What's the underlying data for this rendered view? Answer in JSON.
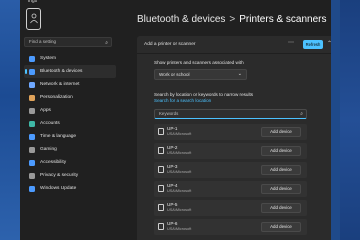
{
  "window": {
    "title": "ings"
  },
  "sidebar": {
    "search_placeholder": "Find a setting",
    "items": [
      {
        "label": "System",
        "icon": "system-icon",
        "color": "#4c9bff"
      },
      {
        "label": "Bluetooth & devices",
        "icon": "bluetooth-icon",
        "color": "#4c9bff",
        "active": true
      },
      {
        "label": "Network & internet",
        "icon": "network-icon",
        "color": "#6fa8ff"
      },
      {
        "label": "Personalization",
        "icon": "brush-icon",
        "color": "#e0a35a"
      },
      {
        "label": "Apps",
        "icon": "apps-icon",
        "color": "#9a9a9a"
      },
      {
        "label": "Accounts",
        "icon": "accounts-icon",
        "color": "#3fb8a6"
      },
      {
        "label": "Time & language",
        "icon": "globe-icon",
        "color": "#4c9bff"
      },
      {
        "label": "Gaming",
        "icon": "gaming-icon",
        "color": "#9a9a9a"
      },
      {
        "label": "Accessibility",
        "icon": "accessibility-icon",
        "color": "#4c9bff"
      },
      {
        "label": "Privacy & security",
        "icon": "shield-icon",
        "color": "#9a9a9a"
      },
      {
        "label": "Windows Update",
        "icon": "update-icon",
        "color": "#4c9bff"
      }
    ]
  },
  "main": {
    "breadcrumb_parent": "Bluetooth & devices",
    "breadcrumb_sep": ">",
    "breadcrumb_current": "Printers & scanners",
    "panel": {
      "header_label": "Add a printer or scanner",
      "refresh_label": "Refresh",
      "show_label": "Show printers and scanners associated with",
      "dropdown_value": "Work or school",
      "search_label": "Search by location or keywords to narrow results",
      "search_link": "Search for a search location",
      "keywords_placeholder": "Keywords",
      "devices": [
        {
          "name": "UP-1",
          "sub": "USA\\Microsoft",
          "button": "Add device"
        },
        {
          "name": "UP-2",
          "sub": "USA\\Microsoft",
          "button": "Add device"
        },
        {
          "name": "UP-3",
          "sub": "USA\\Microsoft",
          "button": "Add device"
        },
        {
          "name": "UP-4",
          "sub": "USA\\Microsoft",
          "button": "Add device"
        },
        {
          "name": "UP-5",
          "sub": "USA\\Microsoft",
          "button": "Add device"
        },
        {
          "name": "UP-6",
          "sub": "USA\\Microsoft",
          "button": "Add device"
        }
      ]
    }
  },
  "colors": {
    "accent": "#4cc2ff",
    "window_bg": "#202020",
    "card_bg": "#2b2b2b"
  }
}
